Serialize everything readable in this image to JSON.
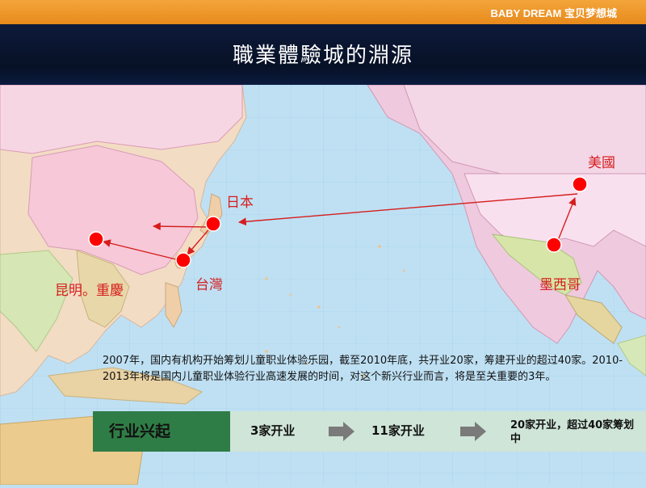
{
  "header": {
    "brand": "BABY DREAM  宝贝梦想城",
    "title": "職業體驗城的淵源"
  },
  "map": {
    "labels": {
      "japan": "日本",
      "taiwan": "台灣",
      "kunming": "昆明。重慶",
      "usa": "美國",
      "mexico": "墨西哥"
    },
    "marker_color": "#ff0000",
    "arrow_color": "#d61d1d"
  },
  "description": "2007年，国内有机构开始筹划儿童职业体验乐园，截至2010年底，共开业20家，筹建开业的超过40家。2010-2013年将是国内儿童职业体验行业高速发展的时间，对这个新兴行业而言，将是至关重要的3年。",
  "timeline": {
    "label": "行业兴起",
    "steps": [
      "3家开业",
      "11家开业",
      "20家开业，超过40家筹划中"
    ]
  }
}
